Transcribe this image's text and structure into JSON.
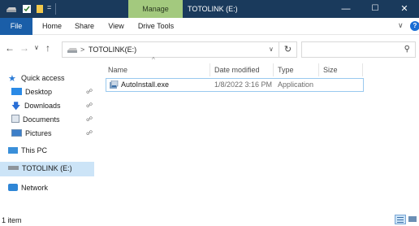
{
  "titlebar": {
    "manage_label": "Manage",
    "title": "TOTOLINK (E:)",
    "buttons": {
      "minimize": "—",
      "maximize": "☐",
      "close": "✕"
    }
  },
  "ribbon": {
    "tabs": [
      "File",
      "Home",
      "Share",
      "View",
      "Drive Tools"
    ],
    "help": "?"
  },
  "address": {
    "path": "TOTOLINK(E:)",
    "separator": ">",
    "search_placeholder": ""
  },
  "nav": {
    "quick_access": "Quick access",
    "items": [
      {
        "label": "Desktop",
        "icon": "desktop-folder-icon",
        "pinned": true
      },
      {
        "label": "Downloads",
        "icon": "download-arrow-icon",
        "pinned": true
      },
      {
        "label": "Documents",
        "icon": "documents-icon",
        "pinned": true
      },
      {
        "label": "Pictures",
        "icon": "pictures-icon",
        "pinned": true
      }
    ],
    "this_pc": "This PC",
    "drive": "TOTOLINK (E:)",
    "network": "Network"
  },
  "columns": [
    "Name",
    "Date modified",
    "Type",
    "Size"
  ],
  "files": [
    {
      "name": "AutoInstall.exe",
      "date": "1/8/2022 3:16 PM",
      "type": "Application",
      "size": ""
    }
  ],
  "status": {
    "count": "1 item"
  },
  "colors": {
    "titlebar": "#1a3a5c",
    "manage": "#a3c97e",
    "file_tab": "#1a5ea8",
    "selection": "#cce4f7"
  }
}
